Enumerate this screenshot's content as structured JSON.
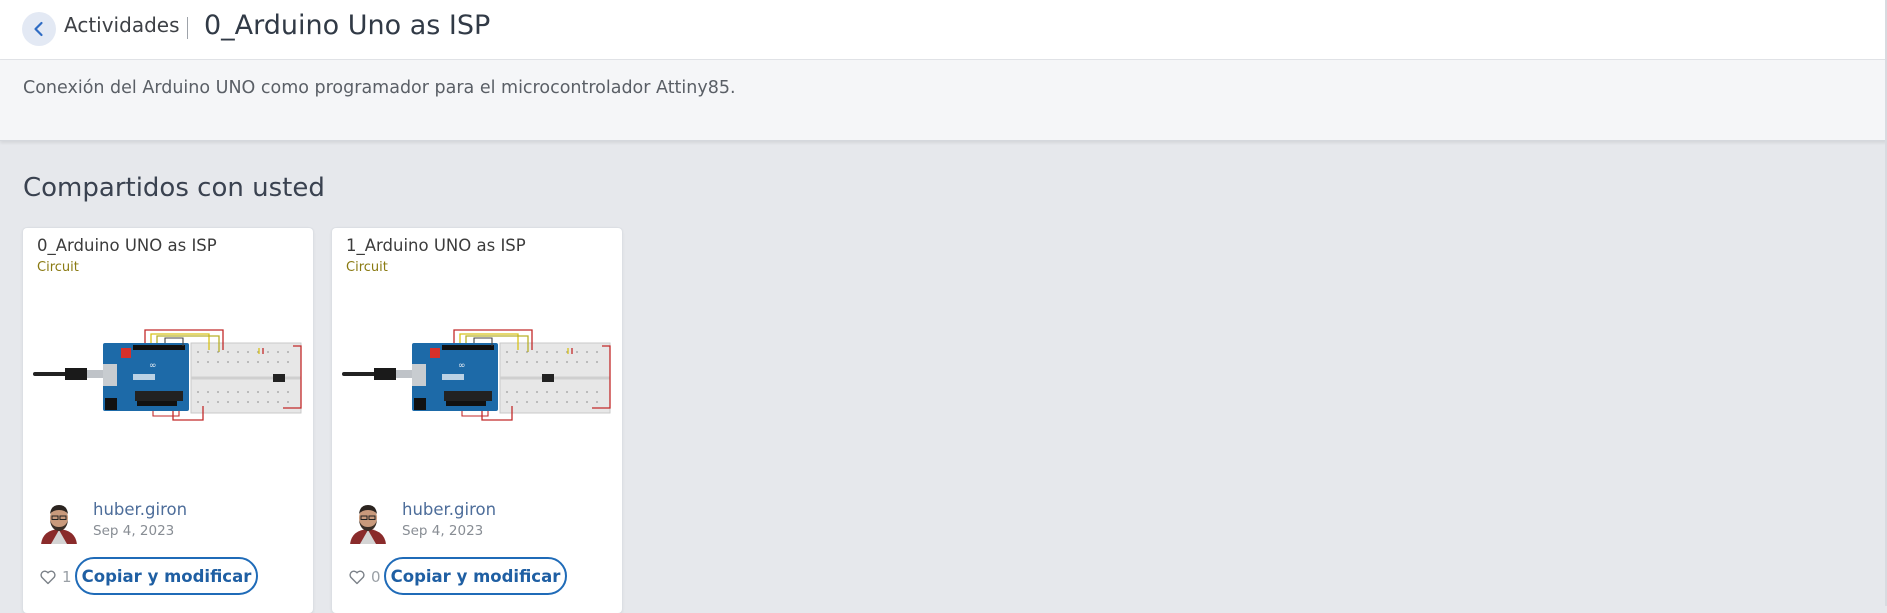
{
  "header": {
    "back_label": "Actividades",
    "title": "0_Arduino Uno as ISP"
  },
  "description": "Conexión del Arduino UNO como programador para el microcontrolador Attiny85.",
  "section_heading": "Compartidos con usted",
  "cards": [
    {
      "title": "0_Arduino UNO as ISP",
      "type": "Circuit",
      "author": "huber.giron",
      "date": "Sep 4, 2023",
      "likes": "1",
      "copy_label": "Copiar y modificar"
    },
    {
      "title": "1_Arduino UNO as ISP",
      "type": "Circuit",
      "author": "huber.giron",
      "date": "Sep 4, 2023",
      "likes": "0",
      "copy_label": "Copiar y modificar"
    }
  ],
  "icons": {
    "back": "chevron-left-icon",
    "like": "heart-outline-icon"
  },
  "colors": {
    "accent": "#1f6bb8",
    "circuit_tag": "#8a7a12",
    "author_link": "#4d6d9a"
  }
}
